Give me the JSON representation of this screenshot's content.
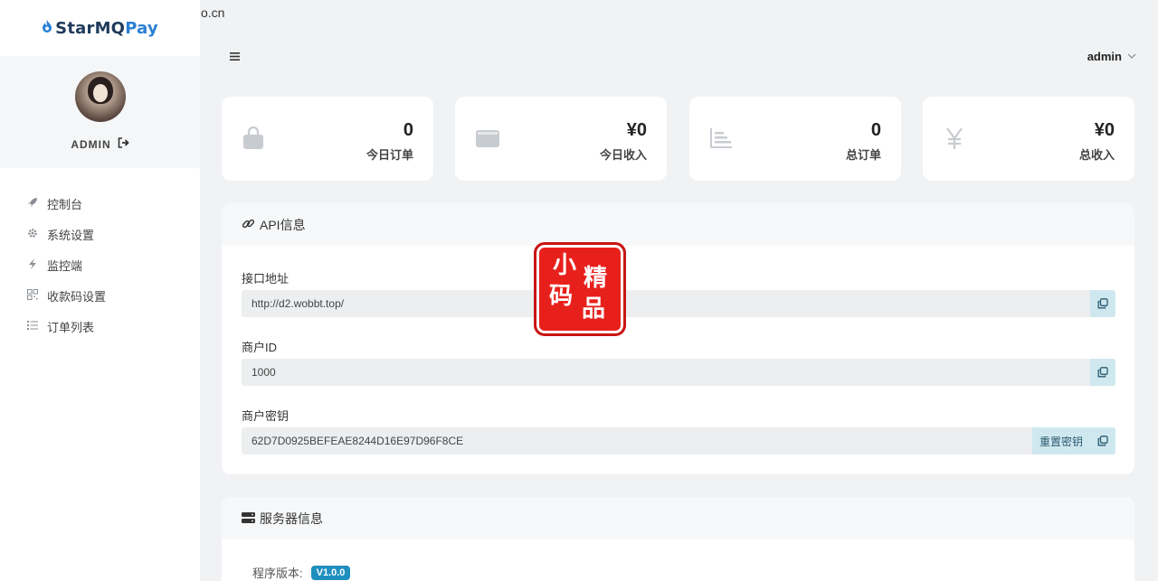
{
  "brand": {
    "name_part1": "StarMQ",
    "name_part2": "Pay"
  },
  "url_fragment": "o.cn",
  "profile": {
    "name": "ADMIN"
  },
  "menu": [
    {
      "label": "控制台",
      "icon": "rocket-icon"
    },
    {
      "label": "系统设置",
      "icon": "gear-icon"
    },
    {
      "label": "监控端",
      "icon": "bolt-icon"
    },
    {
      "label": "收款码设置",
      "icon": "qrcode-icon"
    },
    {
      "label": "订单列表",
      "icon": "list-icon"
    }
  ],
  "topbar": {
    "user": "admin"
  },
  "stats": [
    {
      "value": "0",
      "label": "今日订单",
      "icon": "bag-icon"
    },
    {
      "value": "¥0",
      "label": "今日收入",
      "icon": "wallet-icon"
    },
    {
      "value": "0",
      "label": "总订单",
      "icon": "chart-icon"
    },
    {
      "value": "¥0",
      "label": "总收入",
      "icon": "yen-icon"
    }
  ],
  "api": {
    "title": "API信息",
    "endpoint_label": "接口地址",
    "endpoint_value": "http://d2.wobbt.top/",
    "merchant_id_label": "商户ID",
    "merchant_id_value": "1000",
    "merchant_key_label": "商户密钥",
    "merchant_key_value": "62D7D0925BEFEAE8244D16E97D96F8CE",
    "reset_key_label": "重置密钥"
  },
  "server": {
    "title": "服务器信息",
    "version_label": "程序版本:",
    "version_value": "V1.0.0"
  },
  "watermark": {
    "chars": [
      "小",
      "精",
      "码",
      "品"
    ]
  },
  "colors": {
    "accent": "#2a7fd4",
    "badge": "#1f8fbf",
    "copy_bg": "#cfe8ef",
    "stamp": "#e8201c"
  }
}
